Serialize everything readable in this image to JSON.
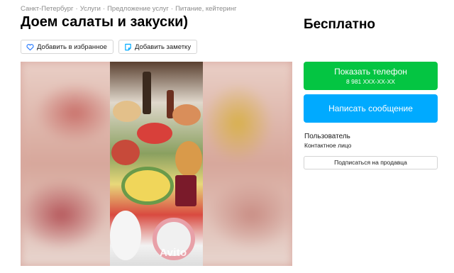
{
  "breadcrumb": {
    "items": [
      "Санкт-Петербург",
      "Услуги",
      "Предложение услуг",
      "Питание, кейтеринг"
    ],
    "separator": "·"
  },
  "listing": {
    "title": "Доем салаты и закуски)",
    "price": "Бесплатно"
  },
  "actions": {
    "favorite_label": "Добавить в избранное",
    "note_label": "Добавить заметку"
  },
  "gallery": {
    "watermark": "Avito"
  },
  "contact": {
    "phone_button_label": "Показать телефон",
    "phone_masked": "8 981 XXX-XX-XX",
    "message_button_label": "Написать сообщение"
  },
  "seller": {
    "name": "Пользователь",
    "type": "Контактное лицо",
    "subscribe_label": "Подписаться на продавца"
  },
  "colors": {
    "phone_button": "#04c542",
    "message_button": "#00aaff",
    "favorite_icon": "#2a7cff",
    "note_icon": "#00aaff"
  }
}
